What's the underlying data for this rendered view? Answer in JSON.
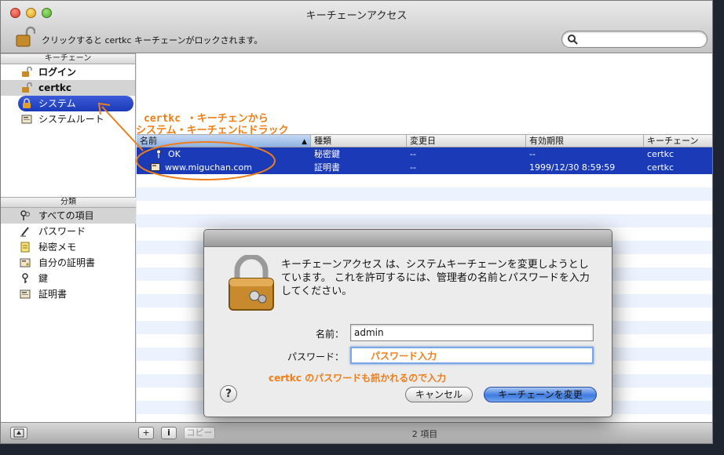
{
  "window": {
    "title": "キーチェーンアクセス"
  },
  "toolbar": {
    "lock_text": "クリックすると certkc キーチェーンがロックされます。",
    "search_placeholder": ""
  },
  "sidebar": {
    "keychains_header": "キーチェーン",
    "keychains": [
      {
        "label": "ログイン",
        "icon": "unlocked-padlock-icon"
      },
      {
        "label": "certkc",
        "icon": "unlocked-padlock-icon"
      },
      {
        "label": "システム",
        "icon": "locked-padlock-icon"
      },
      {
        "label": "システムルート",
        "icon": "certificate-folder-icon"
      }
    ],
    "categories_header": "分類",
    "categories": [
      {
        "label": "すべての項目",
        "icon": "keys-icon"
      },
      {
        "label": "パスワード",
        "icon": "pencil-icon"
      },
      {
        "label": "秘密メモ",
        "icon": "note-icon"
      },
      {
        "label": "自分の証明書",
        "icon": "my-certificate-icon"
      },
      {
        "label": "鍵",
        "icon": "key-icon"
      },
      {
        "label": "証明書",
        "icon": "certificate-icon"
      }
    ]
  },
  "table": {
    "columns": [
      "名前",
      "種類",
      "変更日",
      "有効期限",
      "キーチェーン"
    ],
    "rows": [
      {
        "name": "OK",
        "kind": "秘密鍵",
        "modified": "--",
        "expires": "--",
        "keychain": "certkc",
        "icon": "key-icon"
      },
      {
        "name": "www.miguchan.com",
        "kind": "証明書",
        "modified": "--",
        "expires": "1999/12/30 8:59:59",
        "keychain": "certkc",
        "icon": "certificate-icon"
      }
    ]
  },
  "status": {
    "count": "2 項目",
    "copy_label": "コピー",
    "add_label": "+",
    "info_label": "i"
  },
  "dialog": {
    "message": "キーチェーンアクセス は、システムキーチェーンを変更しようとしています。 これを許可するには、管理者の名前とパスワードを入力してください。",
    "name_label": "名前：",
    "name_value": "admin",
    "password_label": "パスワード：",
    "password_note": "パスワード入力",
    "hint": "certkc のパスワードも訊かれるので入力",
    "help_label": "?",
    "cancel_label": "キャンセル",
    "ok_label": "キーチェーンを変更"
  },
  "annotation": {
    "line1": "certkc ・キーチェンから",
    "line2": "システム・キーチェンにドラック"
  },
  "colors": {
    "selection": "#1b3ab8",
    "annotation": "#ef7e18"
  }
}
